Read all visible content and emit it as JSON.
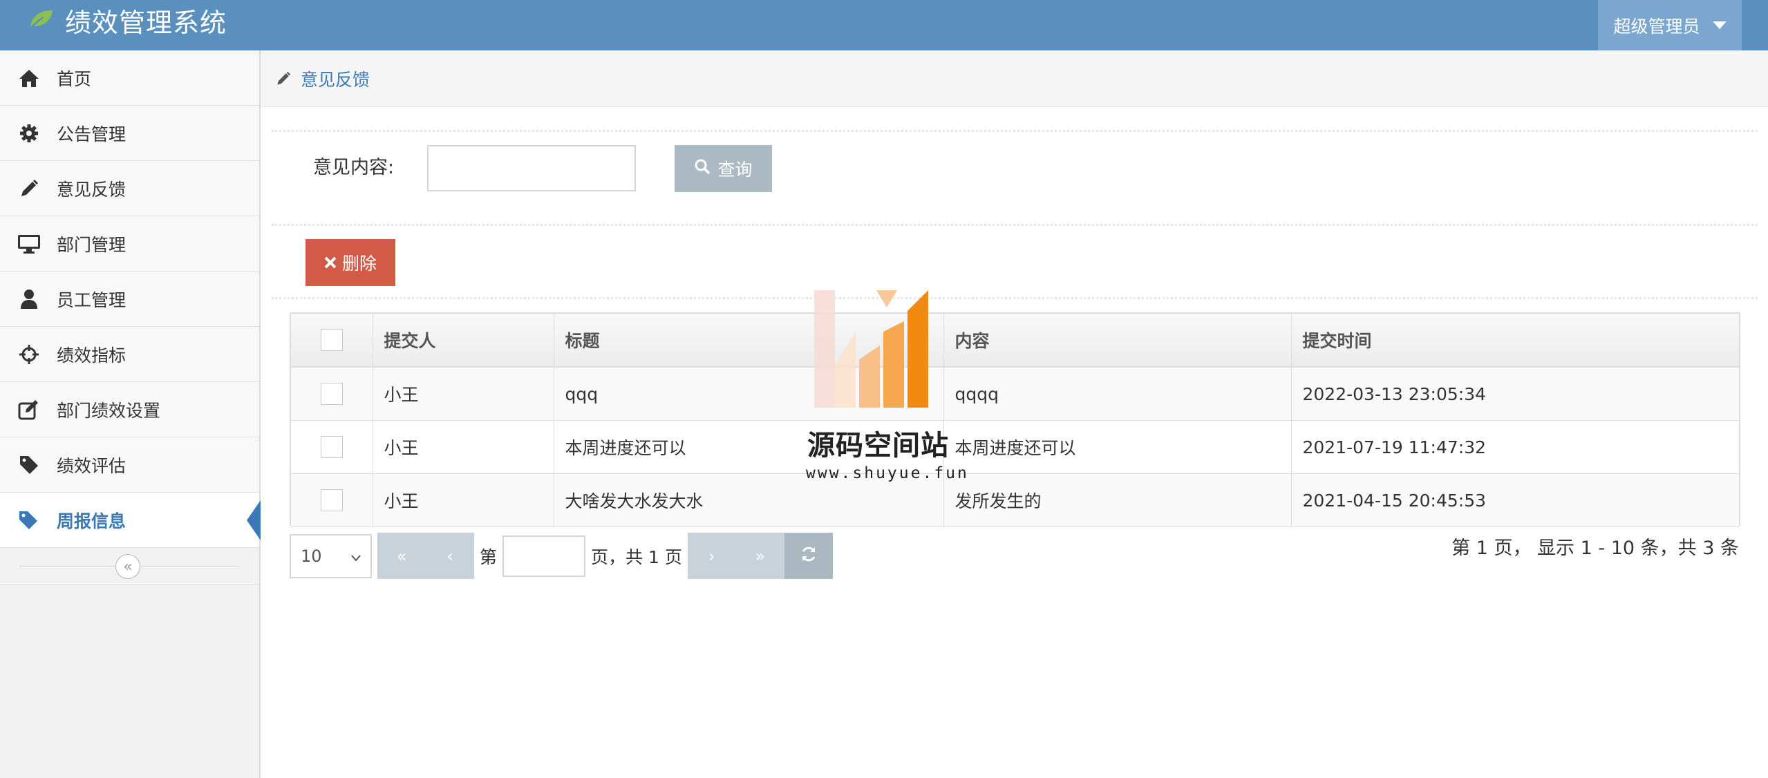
{
  "app": {
    "title": "绩效管理系统",
    "user": "超级管理员"
  },
  "sidebar": {
    "items": [
      {
        "label": "首页",
        "icon": "home-icon"
      },
      {
        "label": "公告管理",
        "icon": "gear-icon"
      },
      {
        "label": "意见反馈",
        "icon": "pencil-icon"
      },
      {
        "label": "部门管理",
        "icon": "monitor-icon"
      },
      {
        "label": "员工管理",
        "icon": "user-icon"
      },
      {
        "label": "绩效指标",
        "icon": "crosshair-icon"
      },
      {
        "label": "部门绩效设置",
        "icon": "edit-icon"
      },
      {
        "label": "绩效评估",
        "icon": "tag-icon"
      },
      {
        "label": "周报信息",
        "icon": "tags-icon",
        "active": true
      }
    ],
    "collapse_glyph": "«"
  },
  "breadcrumb": {
    "current": "意见反馈"
  },
  "search": {
    "label": "意见内容:",
    "value": "",
    "button": "查询"
  },
  "toolbar": {
    "delete_label": "删除"
  },
  "table": {
    "columns": [
      "提交人",
      "标题",
      "内容",
      "提交时间"
    ],
    "rows": [
      [
        "小王",
        "qqq",
        "qqqq",
        "2022-03-13 23:05:34"
      ],
      [
        "小王",
        "本周进度还可以",
        "本周进度还可以",
        "2021-07-19 11:47:32"
      ],
      [
        "小王",
        "大啥发大水发大水",
        "发所发生的",
        "2021-04-15 20:45:53"
      ]
    ]
  },
  "pager": {
    "page_size": "10",
    "page_prefix": "第",
    "page_value": "",
    "page_suffix": "页，共 1 页",
    "info": "第 1 页， 显示 1 - 10 条，共 3 条"
  },
  "watermark": {
    "title": "源码空间站",
    "url": "www.shuyue.fun"
  },
  "colors": {
    "topbar": "#5a8fbe",
    "active": "#3b78b8",
    "delete": "#d15b47",
    "query": "#abbac3"
  }
}
